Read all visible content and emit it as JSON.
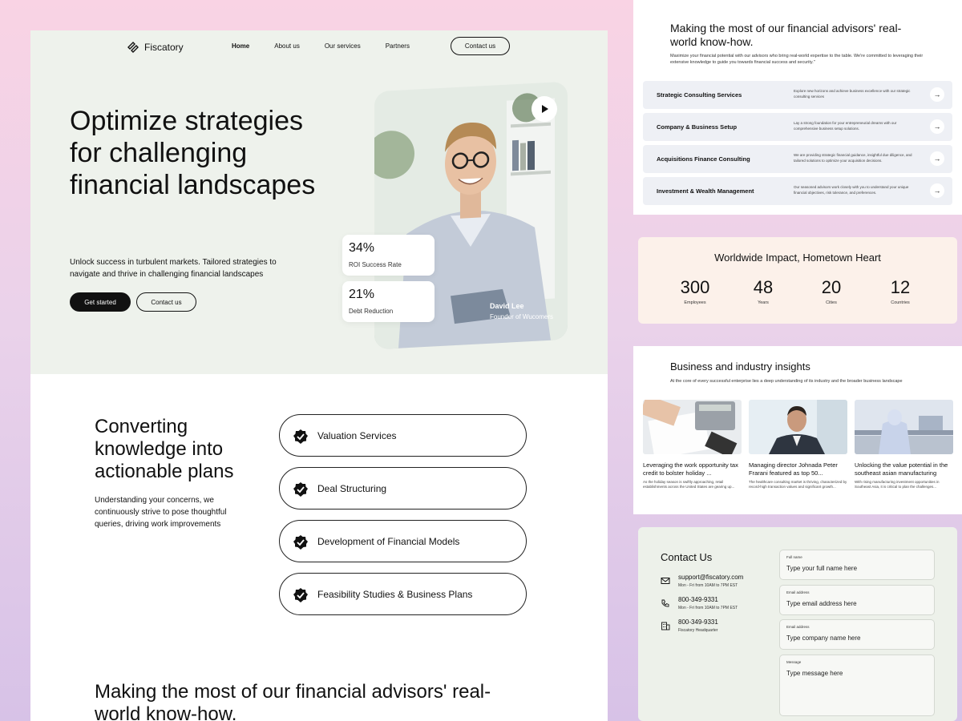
{
  "brand": {
    "name": "Fiscatory"
  },
  "nav": {
    "items": [
      "Home",
      "About us",
      "Our services",
      "Partners"
    ],
    "contact_label": "Contact us"
  },
  "hero": {
    "title": "Optimize strategies for challenging financial landscapes",
    "subtitle": "Unlock success in turbulent markets. Tailored strategies to navigate and thrive in challenging financial landscapes",
    "primary_button": "Get started",
    "secondary_button": "Contact us",
    "stats": [
      {
        "value": "34%",
        "label": "ROI Success Rate"
      },
      {
        "value": "21%",
        "label": "Debt Reduction"
      }
    ],
    "person": {
      "name": "David Lee",
      "role": "Founder of Wucomers"
    }
  },
  "converting": {
    "title": "Converting knowledge into actionable plans",
    "subtitle": "Understanding your concerns, we continuously strive to pose thoughtful queries, driving work improvements",
    "services": [
      "Valuation Services",
      "Deal Structuring",
      "Development of Financial Models",
      "Feasibility Studies & Business Plans"
    ]
  },
  "advisors": {
    "title": "Making the most of our financial advisors' real-world know-how.",
    "subtitle": "Maximize your financial potential with our advisors who bring real-world expertise to the table. We're committed to leveraging their extensive knowledge to guide you towards financial success and security.\"",
    "services": [
      {
        "name": "Strategic Consulting Services",
        "desc": "Explore new horizons and achieve business excellence with our strategic consulting services"
      },
      {
        "name": "Company & Business Setup",
        "desc": "Lay a strong foundation for your entrepreneurial dreams with our comprehensive business setup solutions."
      },
      {
        "name": "Acquisitions Finance Consulting",
        "desc": "We are providing strategic financial guidance, insightful due diligence, and tailored solutions to optimize your acquisition decisions."
      },
      {
        "name": "Investment & Wealth Management",
        "desc": "Our seasoned advisors work closely with you to understand your unique financial objectives, risk tolerance, and preferences."
      }
    ]
  },
  "impact": {
    "title": "Worldwide Impact, Hometown Heart",
    "metrics": [
      {
        "value": "300",
        "label": "Employees"
      },
      {
        "value": "48",
        "label": "Years"
      },
      {
        "value": "20",
        "label": "Cities"
      },
      {
        "value": "12",
        "label": "Countries"
      }
    ]
  },
  "insights": {
    "title": "Business and industry insights",
    "subtitle": "At the core of every successful enterprise lies a deep understanding of its industry and the broader business landscape",
    "articles": [
      {
        "title": "Leveraging the work opportunity tax credit to bolster holiday ...",
        "excerpt": "As the holiday season is swiftly approaching, retail establishments across the United States are gearing up..."
      },
      {
        "title": "Managing director Johnada Peter Frarani featured as top 50...",
        "excerpt": "The healthcare consulting market is thriving, characterized by record-high transaction values and significant growth..."
      },
      {
        "title": "Unlocking the value potential in the southeast asian manufacturing",
        "excerpt": "With rising manufacturing investment opportunities in Southeast Asia, it is critical to plan the challenges..."
      }
    ]
  },
  "contact": {
    "title": "Contact Us",
    "items": [
      {
        "icon": "mail-icon",
        "main": "support@fiscatory.com",
        "sub": "Mon - Fri from 10AM to 7PM EST"
      },
      {
        "icon": "phone-icon",
        "main": "800-349-9331",
        "sub": "Mon - Fri from 10AM to 7PM EST"
      },
      {
        "icon": "building-icon",
        "main": "800-349-9331",
        "sub": "Fiscatory Headquarter"
      }
    ],
    "fields": [
      {
        "label": "Full name",
        "placeholder": "Type your full name here"
      },
      {
        "label": "Email address",
        "placeholder": "Type email address here"
      },
      {
        "label": "Email address",
        "placeholder": "Type company name here"
      },
      {
        "label": "Message",
        "placeholder": "Type message here"
      }
    ]
  }
}
